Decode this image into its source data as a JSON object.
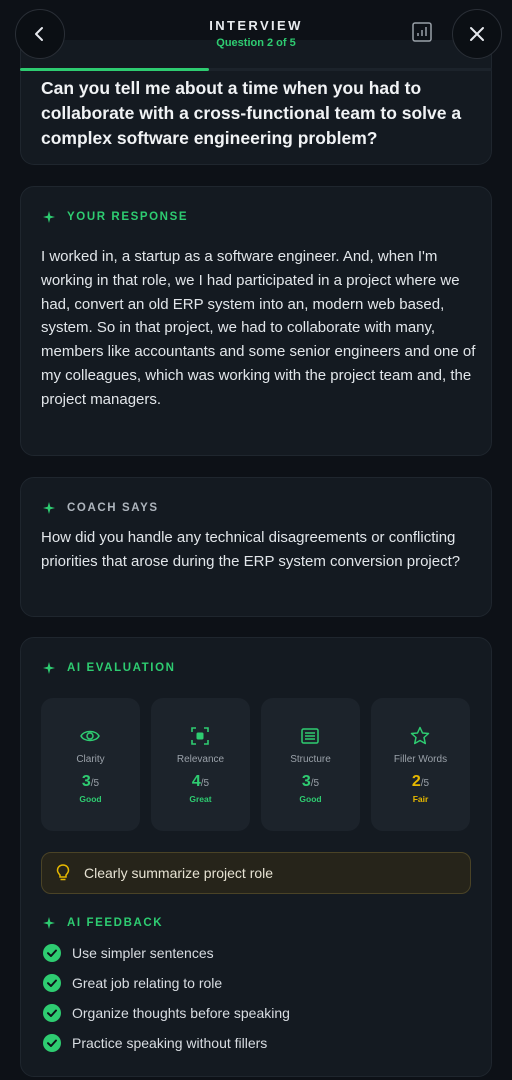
{
  "header": {
    "title": "INTERVIEW",
    "subtitle": "Question 2 of 5",
    "progress_fraction": 0.4
  },
  "question": {
    "text": "Can you tell me about a time when you had to collaborate with a cross-functional team to solve a complex software engineering problem?"
  },
  "response": {
    "label": "YOUR RESPONSE",
    "text": "I worked in, a startup as a software engineer. And, when I'm working in that role, we I had participated in a project where we had, convert an old ERP system into an, modern web based, system. So in that project, we had to collaborate with many, members like accountants and some senior engineers and one of my colleagues, which was working with the project team and, the project managers."
  },
  "coach": {
    "label": "COACH SAYS",
    "text": "How did you handle any technical disagreements or conflicting priorities that arose during the ERP system conversion project?"
  },
  "evaluation": {
    "label": "AI EVALUATION",
    "metrics": [
      {
        "label": "Clarity",
        "score": "3",
        "denominator": "/5",
        "rating": "Good",
        "icon": "eye-icon",
        "color": "#2ecc71"
      },
      {
        "label": "Relevance",
        "score": "4",
        "denominator": "/5",
        "rating": "Great",
        "icon": "target-icon",
        "color": "#2ecc71"
      },
      {
        "label": "Structure",
        "score": "3",
        "denominator": "/5",
        "rating": "Good",
        "icon": "list-icon",
        "color": "#2ecc71"
      },
      {
        "label": "Filler Words",
        "score": "2",
        "denominator": "/5",
        "rating": "Fair",
        "icon": "star-icon",
        "color": "#e6b800"
      }
    ],
    "tip": "Clearly summarize project role",
    "feedback_label": "AI FEEDBACK",
    "feedback": [
      "Use simpler sentences",
      "Great job relating to role",
      "Organize thoughts before speaking",
      "Practice speaking without fillers"
    ]
  },
  "colors": {
    "accent": "#2ecc71",
    "warning": "#e6b800",
    "background": "#0d1117",
    "card": "#141a21"
  }
}
